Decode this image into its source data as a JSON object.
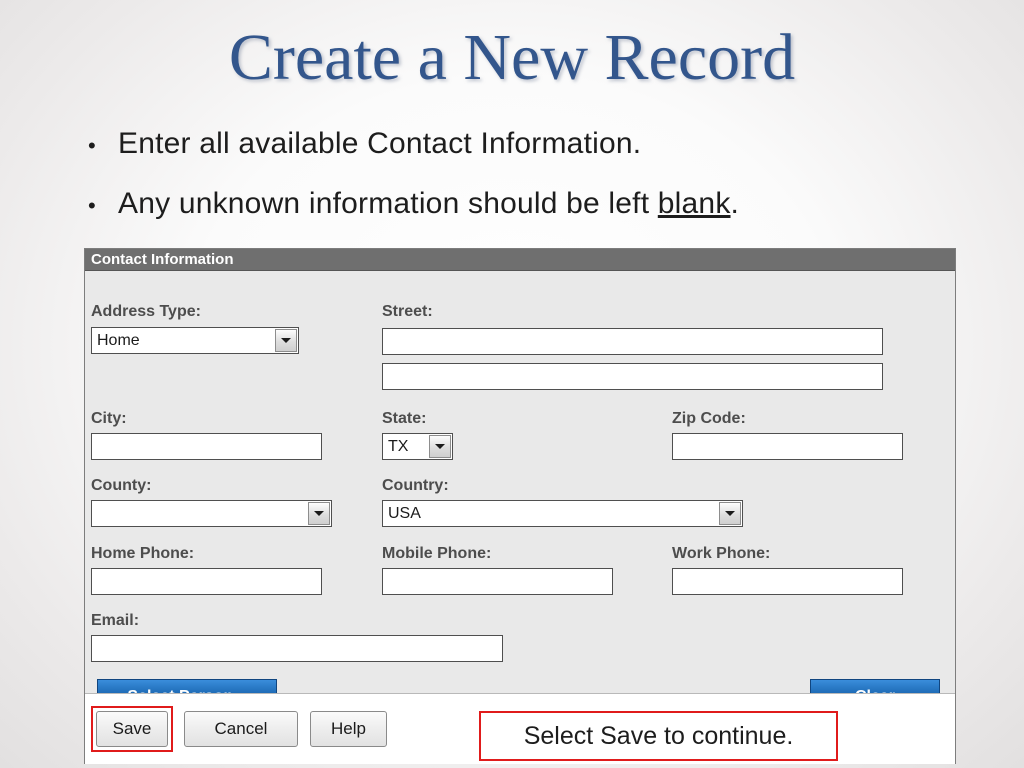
{
  "slide": {
    "title": "Create a New Record",
    "bullets": [
      {
        "dot": "•",
        "pre": "Enter all available Contact Information.",
        "underline": "",
        "post": ""
      },
      {
        "dot": "•",
        "pre": "Any unknown information should be left ",
        "underline": "blank",
        "post": "."
      }
    ]
  },
  "form": {
    "header": "Contact Information",
    "labels": {
      "address_type": "Address Type:",
      "street": "Street:",
      "city": "City:",
      "state": "State:",
      "zip": "Zip Code:",
      "county": "County:",
      "country": "Country:",
      "home_phone": "Home Phone:",
      "mobile_phone": "Mobile Phone:",
      "work_phone": "Work Phone:",
      "email": "Email:"
    },
    "values": {
      "address_type": "Home",
      "street1": "",
      "street2": "",
      "city": "",
      "state": "TX",
      "zip": "",
      "county": "",
      "country": "USA",
      "home_phone": "",
      "mobile_phone": "",
      "work_phone": "",
      "email": ""
    },
    "buttons": {
      "select_person": "Select Person...",
      "clear": "Clear",
      "save": "Save",
      "cancel": "Cancel",
      "help": "Help"
    }
  },
  "annotation": {
    "callout_text": "Select Save to continue."
  },
  "colors": {
    "title": "#33568c",
    "header_bar": "#6f6f6f",
    "blue_button": "#1763ad",
    "highlight": "#e01b1b"
  }
}
